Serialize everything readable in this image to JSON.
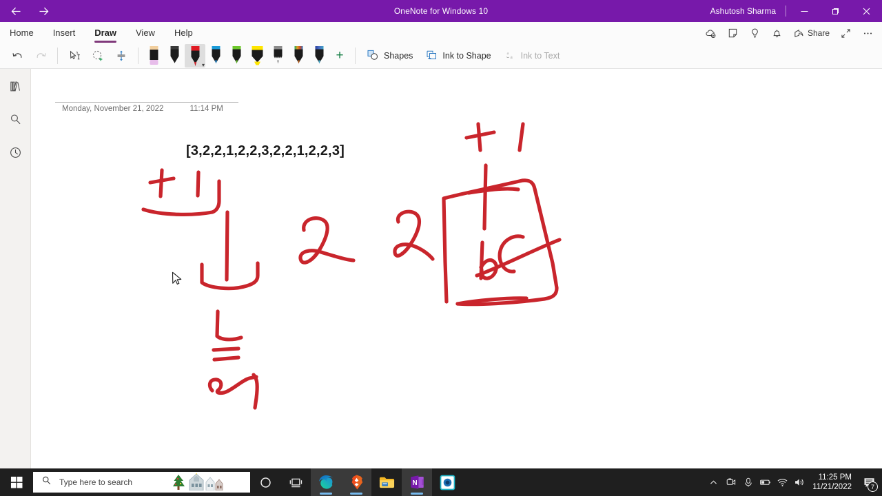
{
  "window": {
    "title": "OneNote for Windows 10",
    "account": "Ashutosh Sharma",
    "back_icon": "back-arrow-icon",
    "forward_icon": "forward-arrow-icon",
    "minimize": "─",
    "maximize": "❐",
    "close": "✕",
    "accent_color": "#7719AA"
  },
  "ribbon": {
    "tabs": [
      {
        "label": "Home",
        "active": false
      },
      {
        "label": "Insert",
        "active": false
      },
      {
        "label": "Draw",
        "active": true
      },
      {
        "label": "View",
        "active": false
      },
      {
        "label": "Help",
        "active": false
      }
    ],
    "right_commands": [
      {
        "label": "",
        "icon": "sync-cloud-icon"
      },
      {
        "label": "",
        "icon": "sticky-note-icon"
      },
      {
        "label": "",
        "icon": "lightbulb-tellme-icon"
      },
      {
        "label": "",
        "icon": "bell-notifications-icon"
      },
      {
        "label": "Share",
        "icon": "share-icon"
      },
      {
        "label": "",
        "icon": "fullscreen-expand-icon"
      },
      {
        "label": "",
        "icon": "more-options-icon"
      }
    ]
  },
  "toolbar": {
    "undo_label": "Undo",
    "redo_label": "Redo",
    "select_label": "Lasso Select Text",
    "lasso_label": "Lasso Select",
    "insert_space_label": "Insert Space",
    "pens": [
      {
        "name": "eraser",
        "body": "#1b1b1b",
        "tip": "#e7bdea",
        "cap": "#f2cf9e",
        "selected": false
      },
      {
        "name": "pen-black",
        "body": "#1b1b1b",
        "tip": "#1b1b1b",
        "cap": "#3a3a3a",
        "selected": false
      },
      {
        "name": "pen-red",
        "body": "#1b1b1b",
        "tip": "#c9252c",
        "cap": "#e01b24",
        "selected": true
      },
      {
        "name": "pen-blue",
        "body": "#1b1b1b",
        "tip": "#1b7fc4",
        "cap": "#1b9bd8",
        "selected": false
      },
      {
        "name": "pen-green",
        "body": "#1b1b1b",
        "tip": "#5bb324",
        "cap": "#6cc72b",
        "selected": false
      },
      {
        "name": "highlighter-yellow",
        "body": "#1b1b1b",
        "tip": "#ffe600",
        "cap": "#ffe600",
        "selected": false
      },
      {
        "name": "pencil-gray",
        "body": "#1b1b1b",
        "tip": "#9b9b9b",
        "cap": "#8b8b8b",
        "selected": false
      },
      {
        "name": "pen-rainbow",
        "body": "#1b1b1b",
        "tip": "#b05a1a",
        "cap": "#e0a020",
        "selected": false
      },
      {
        "name": "pen-galaxy",
        "body": "#1b1b1b",
        "tip": "#3fa3c4",
        "cap": "#4a6fc4",
        "selected": false
      }
    ],
    "add_pen_label": "+",
    "shapes_label": "Shapes",
    "ink_to_shape_label": "Ink to Shape",
    "ink_to_text_label": "Ink to Text",
    "ink_to_text_disabled": true
  },
  "rail": {
    "items": [
      {
        "name": "notebooks-icon",
        "label": "Notebooks"
      },
      {
        "name": "search-icon",
        "label": "Search"
      },
      {
        "name": "recent-notes-icon",
        "label": "Recent Notes"
      }
    ]
  },
  "page": {
    "date": "Monday, November 21, 2022",
    "time": "11:14 PM",
    "array_text": "[3,2,2,1,2,2,3,2,2,1,2,2,3]",
    "ink_color": "#c9252c",
    "ink_annotations": [
      {
        "name": "plus-sign-left",
        "text": "+"
      },
      {
        "name": "digit-one-left",
        "text": "1"
      },
      {
        "name": "bracket-shape-left",
        "text": "bracket"
      },
      {
        "name": "digit-two-middle",
        "text": "2"
      },
      {
        "name": "underline-shape",
        "text": "L"
      },
      {
        "name": "equals-sign",
        "text": "="
      },
      {
        "name": "scribble-lower-left",
        "text": "scribble"
      },
      {
        "name": "plus-sign-right",
        "text": "+"
      },
      {
        "name": "digit-one-right",
        "text": "1"
      },
      {
        "name": "digit-two-right",
        "text": "2"
      },
      {
        "name": "box-shape-right",
        "text": "rectangle"
      },
      {
        "name": "one-c-inside-box",
        "text": "1c"
      }
    ]
  },
  "taskbar": {
    "start_label": "Start",
    "search_placeholder": "Type here to search",
    "apps": [
      {
        "name": "cortana-icon",
        "label": "Cortana",
        "active": false
      },
      {
        "name": "task-view-icon",
        "label": "Task View",
        "active": false
      },
      {
        "name": "edge-icon",
        "label": "Microsoft Edge",
        "active": true
      },
      {
        "name": "brave-icon",
        "label": "Brave Browser",
        "active": true
      },
      {
        "name": "file-explorer-icon",
        "label": "File Explorer",
        "active": false
      },
      {
        "name": "onenote-icon",
        "label": "OneNote",
        "active": true
      },
      {
        "name": "camera-app-icon",
        "label": "Camera",
        "active": false
      }
    ],
    "tray": [
      {
        "name": "show-hidden-icons",
        "glyph": "⌃"
      },
      {
        "name": "camera-tray-icon"
      },
      {
        "name": "microphone-tray-icon"
      },
      {
        "name": "battery-tray-icon"
      },
      {
        "name": "wifi-tray-icon"
      },
      {
        "name": "volume-tray-icon"
      }
    ],
    "time": "11:25 PM",
    "date": "11/21/2022",
    "notification_count": "7"
  }
}
